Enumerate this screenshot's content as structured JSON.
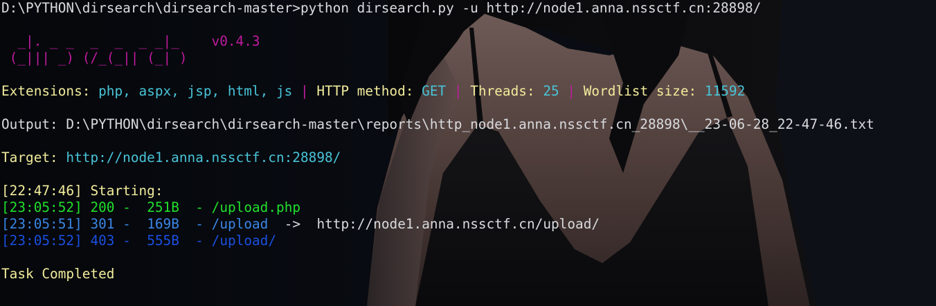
{
  "prompt": {
    "path": "D:\\PYTHON\\dirsearch\\dirsearch-master>",
    "command": "python dirsearch.py -u http://node1.anna.nssctf.cn:28898/"
  },
  "banner": {
    "logo_line1": "  _|. _ _  _  _  _ _|_    ",
    "version": "v0.4.3",
    "logo_line2": " (_||| _) (/_(_|| (_| )"
  },
  "config": {
    "extensions_label": "Extensions:",
    "extensions_value": "php, aspx, jsp, html, js",
    "separator": "|",
    "method_label": "HTTP method:",
    "method_value": "GET",
    "threads_label": "Threads:",
    "threads_value": "25",
    "wordlist_label": "Wordlist size:",
    "wordlist_value": "11592"
  },
  "output": {
    "label": "Output:",
    "path": "D:\\PYTHON\\dirsearch\\dirsearch-master\\reports\\http_node1.anna.nssctf.cn_28898\\__23-06-28_22-47-46.txt"
  },
  "target": {
    "label": "Target:",
    "url": "http://node1.anna.nssctf.cn:28898/"
  },
  "scan": {
    "start_time": "[22:47:46]",
    "start_text": "Starting:",
    "results": [
      {
        "time": "[23:05:52]",
        "status": "200",
        "dash1": "-",
        "size": "251B",
        "dash2": "-",
        "path": "/upload.php",
        "redirect_arrow": "",
        "redirect": ""
      },
      {
        "time": "[23:05:51]",
        "status": "301",
        "dash1": "-",
        "size": "169B",
        "dash2": "-",
        "path": "/upload",
        "redirect_arrow": "->",
        "redirect": "http://node1.anna.nssctf.cn/upload/"
      },
      {
        "time": "[23:05:52]",
        "status": "403",
        "dash1": "-",
        "size": "555B",
        "dash2": "-",
        "path": "/upload/",
        "redirect_arrow": "",
        "redirect": ""
      }
    ],
    "completed": "Task Completed"
  },
  "colors": {
    "default_text": "#d9dbdf",
    "label_yellow": "#f2ec9c",
    "value_cyan": "#49c4d8",
    "logo_magenta": "#c01b9e",
    "status_200": "#21e02c",
    "status_301": "#3b86e6",
    "status_403": "#1b4fe0"
  }
}
